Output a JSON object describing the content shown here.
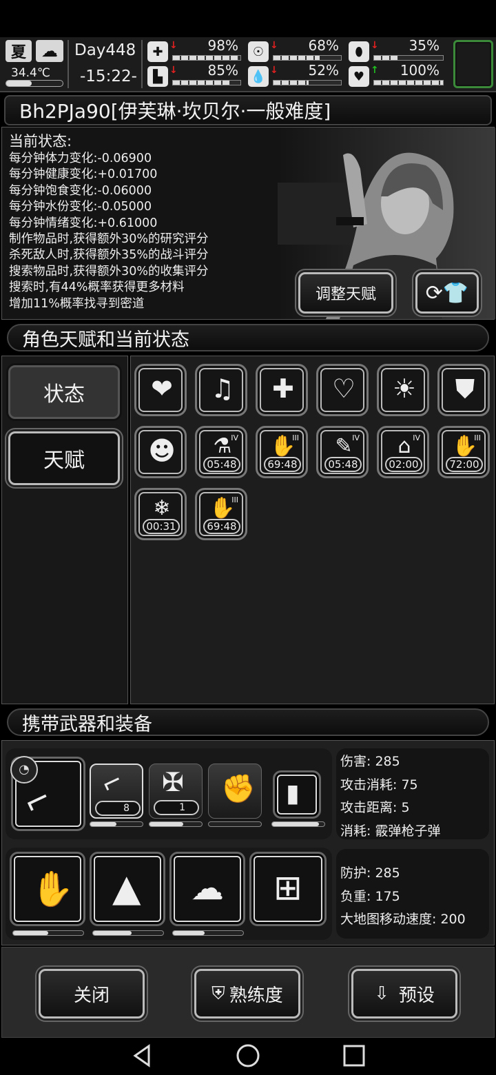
{
  "hud": {
    "season": "夏",
    "weather_icon": "cloud-icon",
    "temperature": "34.4℃",
    "day": "Day448",
    "time": "-15:22-",
    "stats": [
      {
        "name": "health",
        "icon": "medkit-icon",
        "value": "98%",
        "fill": 0.98,
        "trend": "down",
        "trend_color": "#e02020"
      },
      {
        "name": "hunger",
        "icon": "stomach-icon",
        "value": "68%",
        "fill": 0.68,
        "trend": "down",
        "trend_color": "#e02020"
      },
      {
        "name": "mood",
        "icon": "pill-icon",
        "value": "35%",
        "fill": 0.35,
        "trend": "down",
        "trend_color": "#e02020"
      },
      {
        "name": "stamina",
        "icon": "boot-icon",
        "value": "85%",
        "fill": 0.85,
        "trend": "down",
        "trend_color": "#e02020"
      },
      {
        "name": "water",
        "icon": "drop-icon",
        "value": "52%",
        "fill": 0.52,
        "trend": "down",
        "trend_color": "#e02020"
      },
      {
        "name": "heart",
        "icon": "heart-icon",
        "value": "100%",
        "fill": 1.0,
        "trend": "up",
        "trend_color": "#20c020"
      }
    ],
    "accent": "#3a8a3a"
  },
  "character": {
    "title": "Bh2PJa90[伊芙琳·坎贝尔·一般难度]",
    "status_heading": "当前状态:",
    "status_lines": [
      "每分钟体力变化:-0.06900",
      "每分钟健康变化:+0.01700",
      "每分钟饱食变化:-0.06000",
      "每分钟水份变化:-0.05000",
      "每分钟情绪变化:+0.61000",
      "制作物品时,获得额外30%的研究评分",
      "杀死敌人时,获得额外35%的战斗评分",
      "搜索物品时,获得额外30%的收集评分",
      "搜索时,有44%概率获得更多材料",
      "增加11%概率找寻到密道"
    ],
    "adjust_talent_label": "调整天赋",
    "outfit_icon": "change-outfit-icon"
  },
  "talents": {
    "title": "角色天赋和当前状态",
    "tabs": [
      {
        "label": "状态"
      },
      {
        "label": "天赋"
      }
    ],
    "tiles": [
      {
        "icon": "heart-icon",
        "glyph": "❤",
        "timer": "",
        "rank": ""
      },
      {
        "icon": "music-heart-icon",
        "glyph": "♫",
        "timer": "",
        "rank": ""
      },
      {
        "icon": "medicine-icon",
        "glyph": "✚",
        "timer": "",
        "rank": ""
      },
      {
        "icon": "stomach-heart-icon",
        "glyph": "♡",
        "timer": "",
        "rank": ""
      },
      {
        "icon": "alarm-icon",
        "glyph": "☀",
        "timer": "",
        "rank": ""
      },
      {
        "icon": "shirt-icon",
        "glyph": "👕",
        "timer": "",
        "rank": ""
      },
      {
        "icon": "person-icon",
        "glyph": "☻",
        "timer": "",
        "rank": ""
      },
      {
        "icon": "flask-boost-icon",
        "glyph": "⚗",
        "timer": "05:48",
        "rank": "IV"
      },
      {
        "icon": "hand-icon",
        "glyph": "✋",
        "timer": "69:48",
        "rank": "III"
      },
      {
        "icon": "syringe-boost-icon",
        "glyph": "✎",
        "timer": "05:48",
        "rank": "IV"
      },
      {
        "icon": "house-boost-icon",
        "glyph": "⌂",
        "timer": "02:00",
        "rank": "IV"
      },
      {
        "icon": "hand-icon",
        "glyph": "✋",
        "timer": "72:00",
        "rank": "III"
      },
      {
        "icon": "cold-icon",
        "glyph": "❄",
        "timer": "00:31",
        "rank": ""
      },
      {
        "icon": "hand-icon",
        "glyph": "✋",
        "timer": "69:48",
        "rank": "III"
      }
    ]
  },
  "equipment": {
    "title": "携带武器和装备",
    "weapon_stats": [
      "伤害: 285",
      "攻击消耗: 75",
      "攻击距离: 5",
      "消耗: 霰弹枪子弹"
    ],
    "armor_stats": [
      "防护: 285",
      "负重: 175",
      "大地图移动速度: 200"
    ],
    "weapons": [
      {
        "icon": "shotgun-icon",
        "count": "",
        "durability": null
      },
      {
        "icon": "shotgun-icon",
        "count": "8",
        "durability": 0.5
      },
      {
        "icon": "crossbow-icon",
        "count": "1",
        "durability": 0.65
      },
      {
        "icon": "fist-icon",
        "count": "",
        "durability": 0
      },
      {
        "icon": "flashlight-icon",
        "count": "",
        "durability": 0.9
      }
    ],
    "armor": [
      {
        "icon": "gloves-icon",
        "durability": 0.5
      },
      {
        "icon": "cloak-icon",
        "durability": 0.55
      },
      {
        "icon": "boots-icon",
        "durability": 0.45
      },
      {
        "icon": "backpack-frame-icon",
        "durability": null
      }
    ]
  },
  "footer": {
    "close_label": "关闭",
    "proficiency_label": "熟练度",
    "preset_label": "预设"
  }
}
